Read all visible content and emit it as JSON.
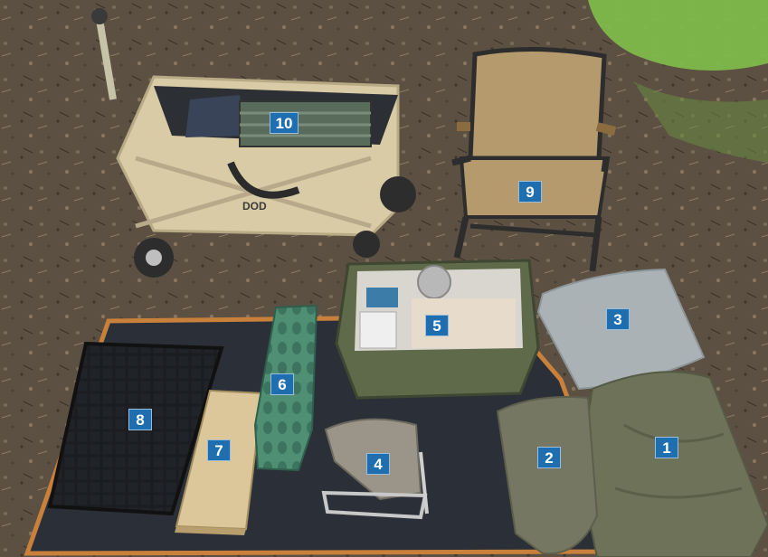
{
  "photo": {
    "wagon_logo_text": "DOD"
  },
  "labels": [
    {
      "id": "1",
      "item": "tent bag"
    },
    {
      "id": "2",
      "item": "tarp bag"
    },
    {
      "id": "3",
      "item": "pillow"
    },
    {
      "id": "4",
      "item": "stove"
    },
    {
      "id": "5",
      "item": "storage box"
    },
    {
      "id": "6",
      "item": "sleeping mat"
    },
    {
      "id": "7",
      "item": "wooden board"
    },
    {
      "id": "8",
      "item": "grill rack"
    },
    {
      "id": "9",
      "item": "folding chair"
    },
    {
      "id": "10",
      "item": "folding table"
    }
  ],
  "colors": {
    "ground": "#5c5043",
    "grass": "#7fbf4a",
    "tarp": "#2b3038",
    "tarp_border": "#c9803b",
    "olive": "#6d7259",
    "canvas": "#d9cba5",
    "label_bg": "#1f6fb0"
  }
}
